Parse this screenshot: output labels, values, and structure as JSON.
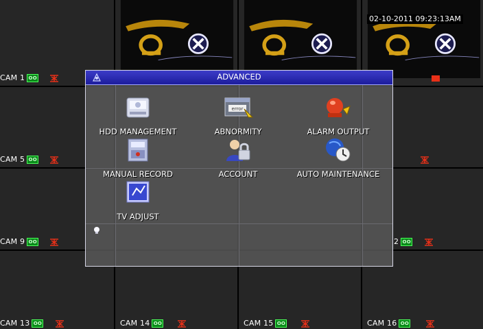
{
  "timestamp": "02-10-2011 09:23:13AM",
  "cameras": [
    {
      "label": "CAM 1"
    },
    {
      "label": ""
    },
    {
      "label": ""
    },
    {
      "label": ""
    },
    {
      "label": "CAM 5"
    },
    {
      "label": ""
    },
    {
      "label": ""
    },
    {
      "label": ""
    },
    {
      "label": "CAM 9"
    },
    {
      "label": ""
    },
    {
      "label": ""
    },
    {
      "label": "2"
    },
    {
      "label": "CAM 13"
    },
    {
      "label": "CAM 14"
    },
    {
      "label": "CAM 15"
    },
    {
      "label": "CAM 16"
    }
  ],
  "rec_badge": "OO",
  "dialog": {
    "title": "ADVANCED",
    "items": [
      {
        "label": "HDD MANAGEMENT",
        "icon": "hdd-icon"
      },
      {
        "label": "ABNORMITY",
        "icon": "abnormity-icon"
      },
      {
        "label": "ALARM OUTPUT",
        "icon": "alarm-output-icon"
      },
      {
        "label": "MANUAL RECORD",
        "icon": "manual-record-icon"
      },
      {
        "label": "ACCOUNT",
        "icon": "account-icon"
      },
      {
        "label": "AUTO MAINTENANCE",
        "icon": "auto-maintenance-icon"
      },
      {
        "label": "TV ADJUST",
        "icon": "tv-adjust-icon"
      }
    ]
  },
  "colors": {
    "titlebar": "#2424b0",
    "rec_green": "#0a8a1a",
    "alarm_red": "#e83018"
  }
}
